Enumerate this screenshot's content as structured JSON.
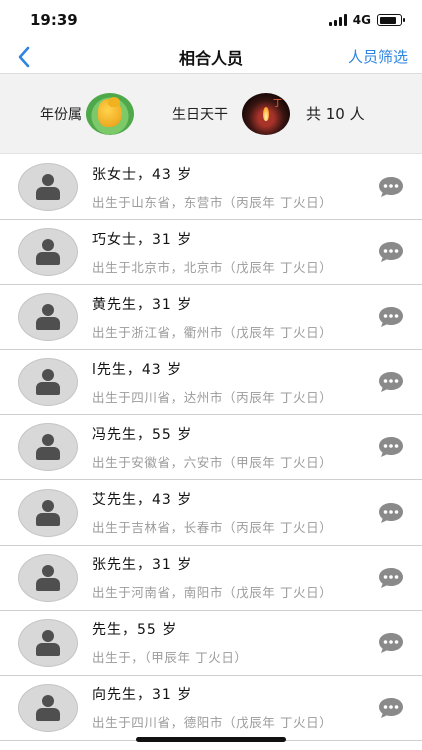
{
  "status": {
    "time": "19:39",
    "network": "4G"
  },
  "nav": {
    "title": "相合人员",
    "filter_label": "人员筛选"
  },
  "summary": {
    "year_label": "年份属",
    "stem_label": "生日天干",
    "count_label": "共 10 人",
    "stem_glyph": "丁"
  },
  "people": [
    {
      "name": "张女士，43 岁",
      "detail": "出生于山东省，东营市（丙辰年 丁火日）"
    },
    {
      "name": "巧女士，31 岁",
      "detail": "出生于北京市，北京市（戊辰年 丁火日）"
    },
    {
      "name": "黄先生，31 岁",
      "detail": "出生于浙江省，衢州市（戊辰年 丁火日）"
    },
    {
      "name": "l先生，43 岁",
      "detail": "出生于四川省，达州市（丙辰年 丁火日）"
    },
    {
      "name": "冯先生，55 岁",
      "detail": "出生于安徽省，六安市（甲辰年 丁火日）"
    },
    {
      "name": "艾先生，43 岁",
      "detail": "出生于吉林省，长春市（丙辰年 丁火日）"
    },
    {
      "name": "张先生，31 岁",
      "detail": "出生于河南省，南阳市（戊辰年 丁火日）"
    },
    {
      "name": " 先生，55 岁",
      "detail": "出生于，（甲辰年 丁火日）"
    },
    {
      "name": "向先生，31 岁",
      "detail": "出生于四川省，德阳市（戊辰年 丁火日）"
    }
  ],
  "colors": {
    "accent": "#2f86e0",
    "icon_gray": "#8a8a8a"
  }
}
